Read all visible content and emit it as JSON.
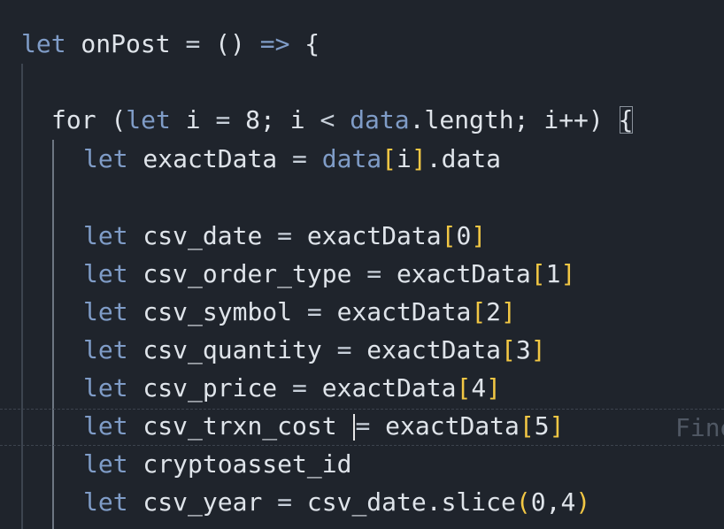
{
  "editor": {
    "lines": [
      {
        "tokens": [
          {
            "t": "let",
            "c": "kw"
          },
          {
            "t": " onPost "
          },
          {
            "t": "=",
            "c": "op"
          },
          {
            "t": " () "
          },
          {
            "t": "=>",
            "c": "kw"
          },
          {
            "t": " {"
          }
        ]
      },
      {
        "tokens": []
      },
      {
        "tokens": [
          {
            "t": "for"
          },
          {
            "t": " ("
          },
          {
            "t": "let",
            "c": "kw"
          },
          {
            "t": " i "
          },
          {
            "t": "=",
            "c": "op"
          },
          {
            "t": " 8; i "
          },
          {
            "t": "<",
            "c": "op"
          },
          {
            "t": " "
          },
          {
            "t": "data",
            "c": "kw"
          },
          {
            "t": ".length; i++) "
          },
          {
            "t": "{",
            "c": "match"
          }
        ]
      },
      {
        "tokens": [
          {
            "t": "let",
            "c": "kw"
          },
          {
            "t": " exactData "
          },
          {
            "t": "=",
            "c": "op"
          },
          {
            "t": " "
          },
          {
            "t": "data",
            "c": "kw"
          },
          {
            "t": "[",
            "c": "br1"
          },
          {
            "t": "i"
          },
          {
            "t": "]",
            "c": "br1"
          },
          {
            "t": ".data"
          }
        ]
      },
      {
        "tokens": []
      },
      {
        "tokens": [
          {
            "t": "let",
            "c": "kw"
          },
          {
            "t": " csv_date "
          },
          {
            "t": "=",
            "c": "op"
          },
          {
            "t": " exactData"
          },
          {
            "t": "[",
            "c": "br1"
          },
          {
            "t": "0"
          },
          {
            "t": "]",
            "c": "br1"
          }
        ]
      },
      {
        "tokens": [
          {
            "t": "let",
            "c": "kw"
          },
          {
            "t": " csv_order_type "
          },
          {
            "t": "=",
            "c": "op"
          },
          {
            "t": " exactData"
          },
          {
            "t": "[",
            "c": "br1"
          },
          {
            "t": "1"
          },
          {
            "t": "]",
            "c": "br1"
          }
        ]
      },
      {
        "tokens": [
          {
            "t": "let",
            "c": "kw"
          },
          {
            "t": " csv_symbol "
          },
          {
            "t": "=",
            "c": "op"
          },
          {
            "t": " exactData"
          },
          {
            "t": "[",
            "c": "br1"
          },
          {
            "t": "2"
          },
          {
            "t": "]",
            "c": "br1"
          }
        ]
      },
      {
        "tokens": [
          {
            "t": "let",
            "c": "kw"
          },
          {
            "t": " csv_quantity "
          },
          {
            "t": "=",
            "c": "op"
          },
          {
            "t": " exactData"
          },
          {
            "t": "[",
            "c": "br1"
          },
          {
            "t": "3"
          },
          {
            "t": "]",
            "c": "br1"
          }
        ]
      },
      {
        "tokens": [
          {
            "t": "let",
            "c": "kw"
          },
          {
            "t": " csv_price "
          },
          {
            "t": "=",
            "c": "op"
          },
          {
            "t": " exactData"
          },
          {
            "t": "[",
            "c": "br1"
          },
          {
            "t": "4"
          },
          {
            "t": "]",
            "c": "br1"
          }
        ]
      },
      {
        "tokens": [
          {
            "t": "let",
            "c": "kw"
          },
          {
            "t": " csv_trxn_cost "
          },
          {
            "t": "",
            "c": "cursor"
          },
          {
            "t": "=",
            "c": "op"
          },
          {
            "t": " exactData"
          },
          {
            "t": "[",
            "c": "br1"
          },
          {
            "t": "5"
          },
          {
            "t": "]",
            "c": "br1"
          }
        ]
      },
      {
        "tokens": [
          {
            "t": "let",
            "c": "kw"
          },
          {
            "t": " cryptoasset_id"
          }
        ]
      },
      {
        "tokens": [
          {
            "t": "let",
            "c": "kw"
          },
          {
            "t": " csv_year "
          },
          {
            "t": "=",
            "c": "op"
          },
          {
            "t": " csv_date.slice"
          },
          {
            "t": "(",
            "c": "br1"
          },
          {
            "t": "0,4"
          },
          {
            "t": ")",
            "c": "br1"
          }
        ]
      }
    ],
    "ghost_text": "Fine"
  }
}
